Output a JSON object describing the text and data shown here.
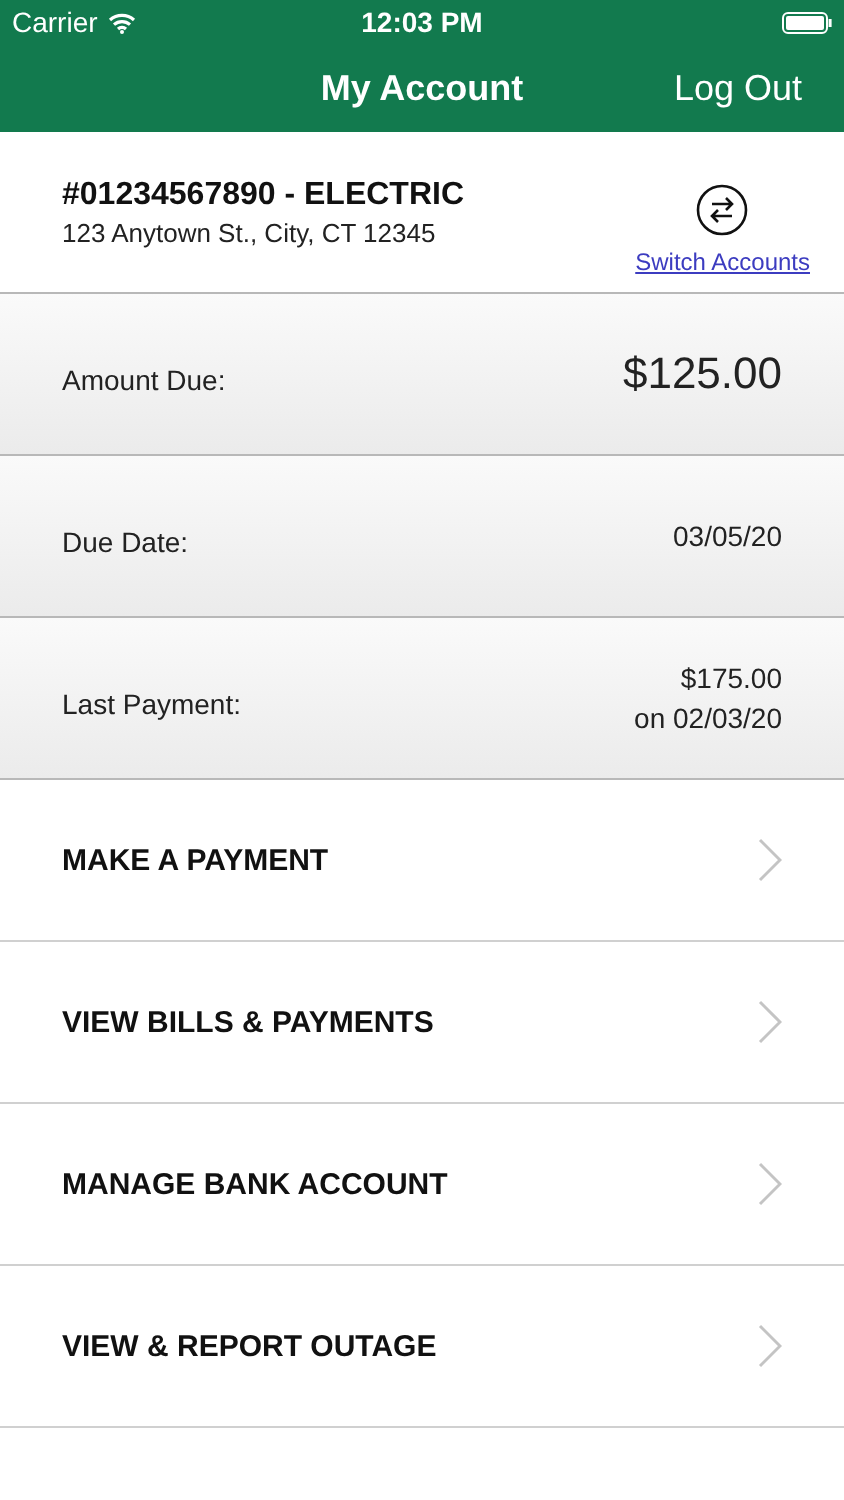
{
  "status_bar": {
    "carrier": "Carrier",
    "time": "12:03 PM"
  },
  "nav": {
    "title": "My Account",
    "action": "Log Out"
  },
  "account": {
    "number": "#01234567890 - ELECTRIC",
    "address": "123 Anytown St., City, CT 12345",
    "switch_label": "Switch Accounts"
  },
  "summary": [
    {
      "label": "Amount Due:",
      "values": [
        "$125.00"
      ],
      "kind": "large"
    },
    {
      "label": "Due Date:",
      "values": [
        "03/05/20"
      ],
      "kind": "plain"
    },
    {
      "label": "Last Payment:",
      "values": [
        "$175.00",
        "on 02/03/20"
      ],
      "kind": "plain"
    }
  ],
  "menu": [
    "MAKE A PAYMENT",
    "VIEW BILLS & PAYMENTS",
    "MANAGE BANK ACCOUNT",
    "VIEW & REPORT OUTAGE"
  ]
}
